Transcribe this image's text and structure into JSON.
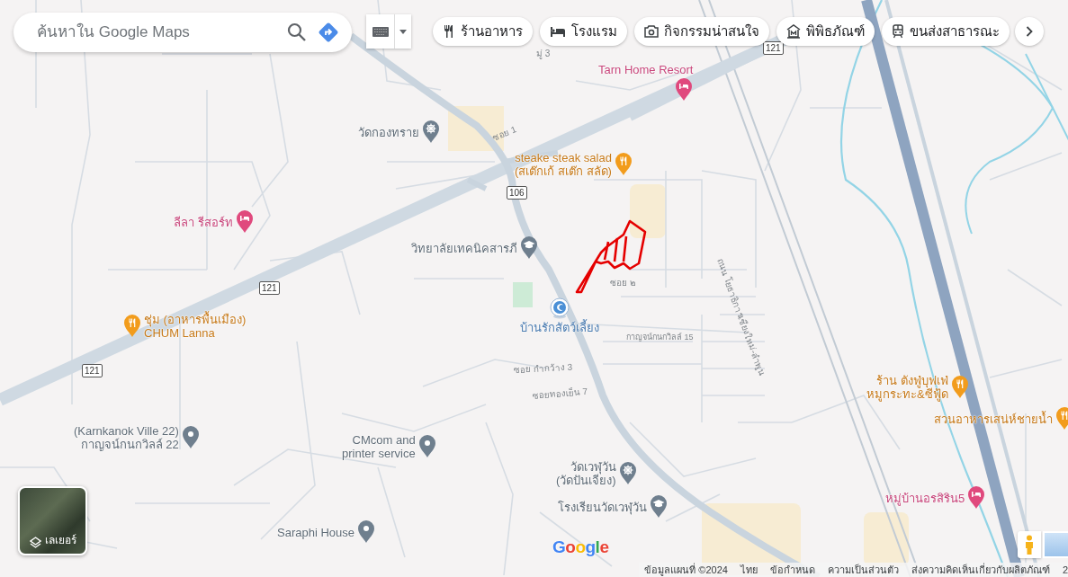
{
  "search": {
    "placeholder": "ค้นหาใน Google Maps"
  },
  "chips": [
    {
      "kind": "restaurant",
      "label": "ร้านอาหาร"
    },
    {
      "kind": "hotel",
      "label": "โรงแรม"
    },
    {
      "kind": "attraction",
      "label": "กิจกรรมน่าสนใจ"
    },
    {
      "kind": "museum",
      "label": "พิพิธภัณฑ์"
    },
    {
      "kind": "transit",
      "label": "ขนส่งสาธารณะ"
    }
  ],
  "places": [
    {
      "kind": "hotel",
      "lines": [
        "Tarn Home Resort"
      ]
    },
    {
      "kind": "temple",
      "lines": [
        "วัดกองทราย"
      ]
    },
    {
      "kind": "restaurant",
      "lines": [
        "steake steak salad",
        "(สเต๊กเก้ สเต๊ก สลัด)"
      ]
    },
    {
      "kind": "hotel",
      "lines": [
        "ลีลา รีสอร์ท"
      ]
    },
    {
      "kind": "school",
      "lines": [
        "วิทยาลัยเทคนิคสารภี"
      ]
    },
    {
      "kind": "restaurant",
      "lines": [
        "ชุ่ม (อาหารพื้นเมือง)",
        "CHUM Lanna"
      ]
    },
    {
      "kind": "pet",
      "lines": [
        "บ้านรักสัตว์เลี้ยง"
      ]
    },
    {
      "kind": "restaurant",
      "lines": [
        "ร้าน ตังฟู่บุฟเฟ่",
        "หมูกระทะ&ซีฟู้ด"
      ]
    },
    {
      "kind": "restaurant",
      "lines": [
        "สวนอาหารเสน่ห์ชายน้ำ"
      ]
    },
    {
      "kind": "place",
      "lines": [
        "(Karnkanok Ville 22)",
        "กาญจน์กนกวิลล์ 22"
      ]
    },
    {
      "kind": "place",
      "lines": [
        "CMcom and",
        "printer service"
      ]
    },
    {
      "kind": "temple",
      "lines": [
        "วัดเวฬุวัน",
        "(วัดปันเจียง)"
      ]
    },
    {
      "kind": "school",
      "lines": [
        "โรงเรียนวัดเวฬุวัน"
      ]
    },
    {
      "kind": "place",
      "lines": [
        "Saraphi House"
      ]
    },
    {
      "kind": "hotel",
      "lines": [
        "หมู่บ้านอรสิริน5"
      ]
    }
  ],
  "road_labels": [
    "มู่ 3",
    "ซอย 1",
    "ซอย ๒",
    "กาญจน์กนกวิลล์ 15",
    "ซอย กำกว้าง 3",
    "ซอยทองเย็น 7",
    "ถนน โยธาธิการเชียงใหม่-ลำพูน"
  ],
  "route_shields": [
    "121",
    "106",
    "121",
    "121"
  ],
  "layers": {
    "label": "เลเยอร์"
  },
  "logo": "Google",
  "footer": [
    "ข้อมูลแผนที่ ©2024",
    "ไทย",
    "ข้อกำหนด",
    "ความเป็นส่วนตัว",
    "ส่งความคิดเห็นเกี่ยวกับผลิตภัณฑ์",
    "2"
  ]
}
